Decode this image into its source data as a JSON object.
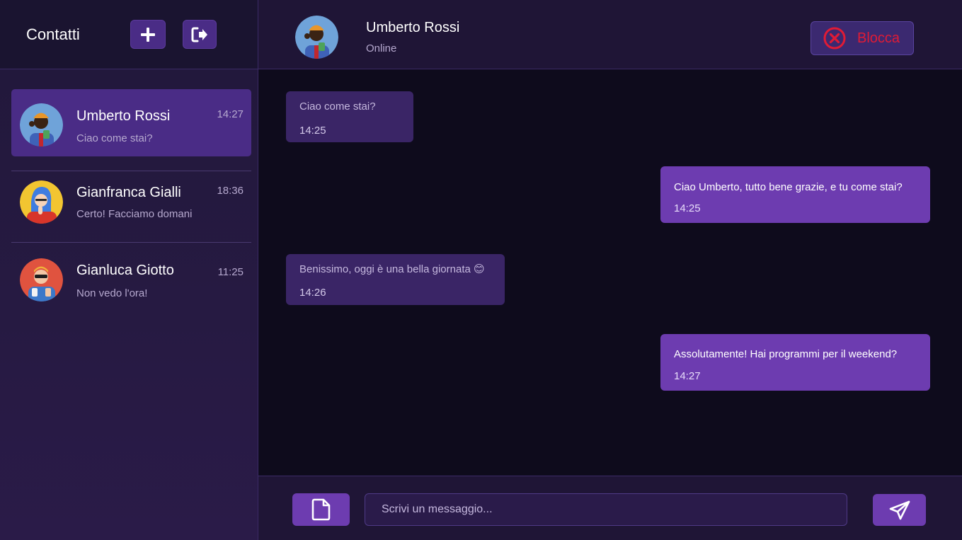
{
  "sidebar": {
    "title": "Contatti",
    "add_icon": "plus-icon",
    "logout_icon": "logout-icon",
    "contacts": [
      {
        "name": "Umberto Rossi",
        "preview": "Ciao come stai?",
        "time": "14:27",
        "active": true
      },
      {
        "name": "Gianfranca Gialli",
        "preview": "Certo! Facciamo domani",
        "time": "18:36",
        "active": false
      },
      {
        "name": "Gianluca Giotto",
        "preview": "Non vedo l'ora!",
        "time": "11:25",
        "active": false
      }
    ]
  },
  "chat_header": {
    "name": "Umberto Rossi",
    "status": "Online",
    "block_label": "Blocca",
    "block_icon": "close-circle-icon"
  },
  "messages": [
    {
      "direction": "in",
      "text": "Ciao come stai?",
      "time": "14:25"
    },
    {
      "direction": "out",
      "text": "Ciao Umberto, tutto bene grazie, e tu come stai?",
      "time": "14:25"
    },
    {
      "direction": "in",
      "text": "Benissimo, oggi è una bella giornata",
      "emoji": "😊",
      "time": "14:26"
    },
    {
      "direction": "out",
      "text": "Assolutamente! Hai programmi per il weekend?",
      "time": "14:27"
    }
  ],
  "input_bar": {
    "placeholder": "Scrivi un messaggio...",
    "attach_icon": "file-icon",
    "send_icon": "send-icon"
  },
  "colors": {
    "accent": "#6d3cb0",
    "sidebar_active": "#4a2c86",
    "incoming_bubble": "#3a2566",
    "block_red": "#e01b35",
    "background": "#0e0b1c"
  }
}
